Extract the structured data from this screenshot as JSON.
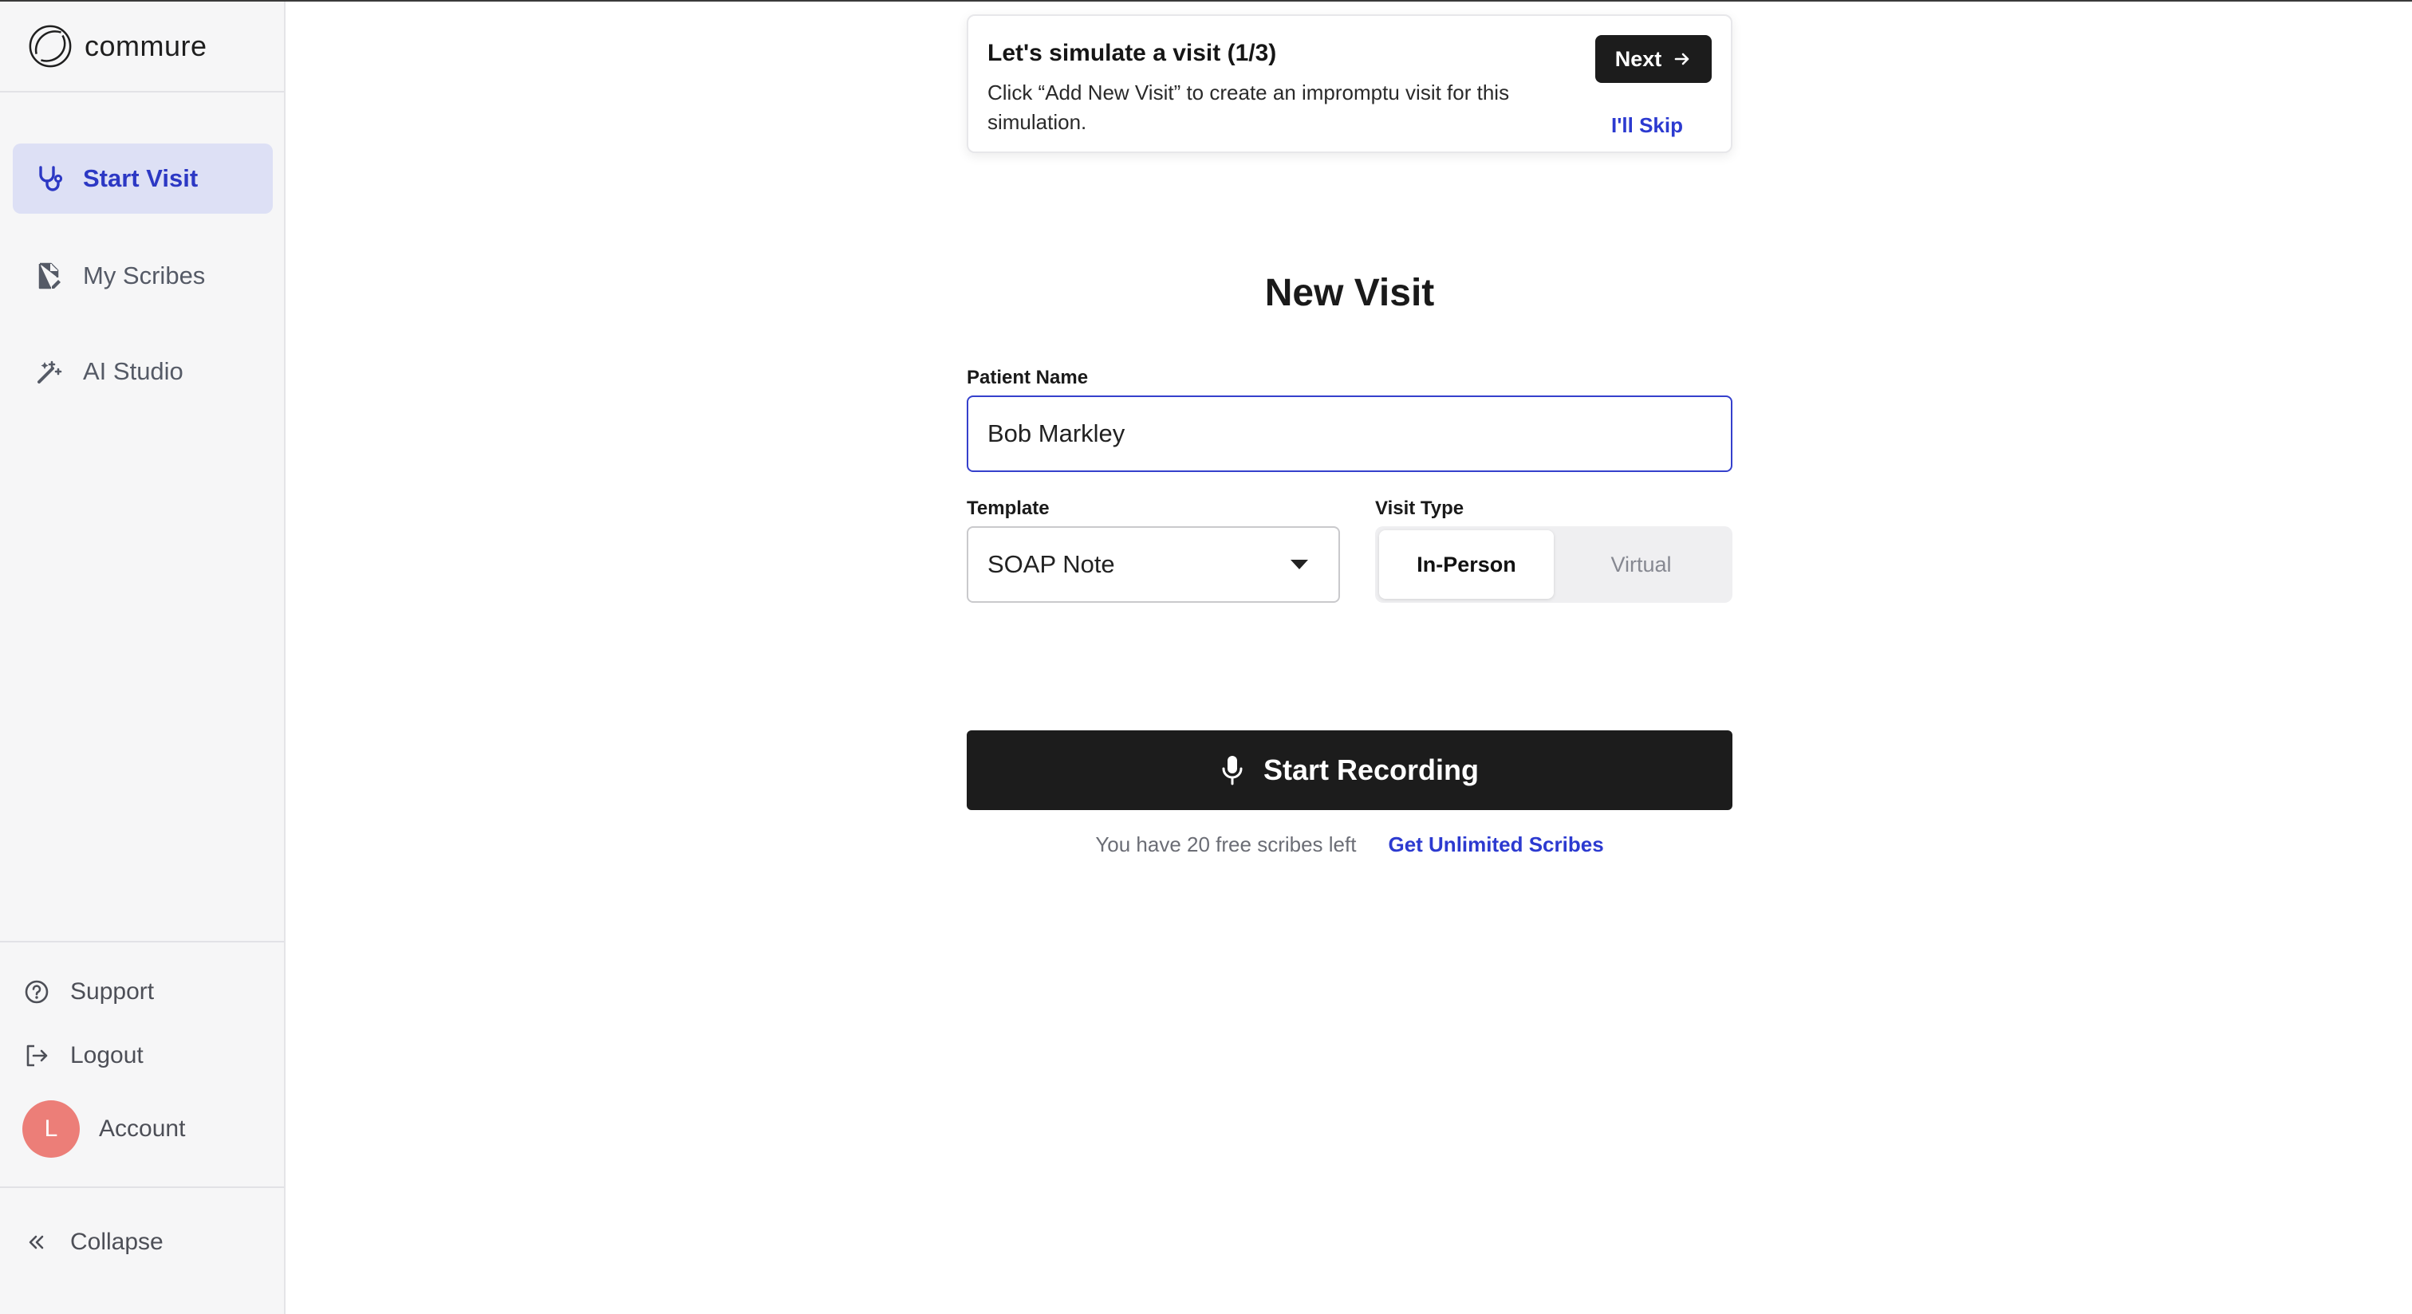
{
  "brand": {
    "name": "commure"
  },
  "sidebar": {
    "items": [
      {
        "label": "Start Visit",
        "icon": "stethoscope-icon",
        "active": true
      },
      {
        "label": "My Scribes",
        "icon": "document-icon",
        "active": false
      },
      {
        "label": "AI Studio",
        "icon": "magic-wand-icon",
        "active": false
      }
    ],
    "bottom": [
      {
        "label": "Support",
        "icon": "question-circle-icon"
      },
      {
        "label": "Logout",
        "icon": "logout-icon"
      },
      {
        "label": "Account",
        "avatar_initial": "L"
      },
      {
        "label": "Collapse",
        "icon": "double-chevron-left-icon"
      }
    ]
  },
  "tour": {
    "title": "Let's simulate a visit (1/3)",
    "text": "Click “Add New Visit” to create an impromptu visit for this simulation.",
    "next_label": "Next",
    "skip_label": "I'll Skip"
  },
  "form": {
    "title": "New Visit",
    "patient_name_label": "Patient Name",
    "patient_name_value": "Bob Markley",
    "template_label": "Template",
    "template_value": "SOAP Note",
    "visit_type_label": "Visit Type",
    "visit_type_options": [
      "In-Person",
      "Virtual"
    ],
    "visit_type_selected": "In-Person",
    "record_label": "Start Recording",
    "free_scribes_text": "You have 20 free scribes left",
    "unlimited_link": "Get Unlimited Scribes"
  },
  "colors": {
    "accent": "#2c38c4",
    "active_bg": "#dde0f5",
    "dark_button": "#1c1c1c",
    "avatar": "#ec7e78"
  }
}
